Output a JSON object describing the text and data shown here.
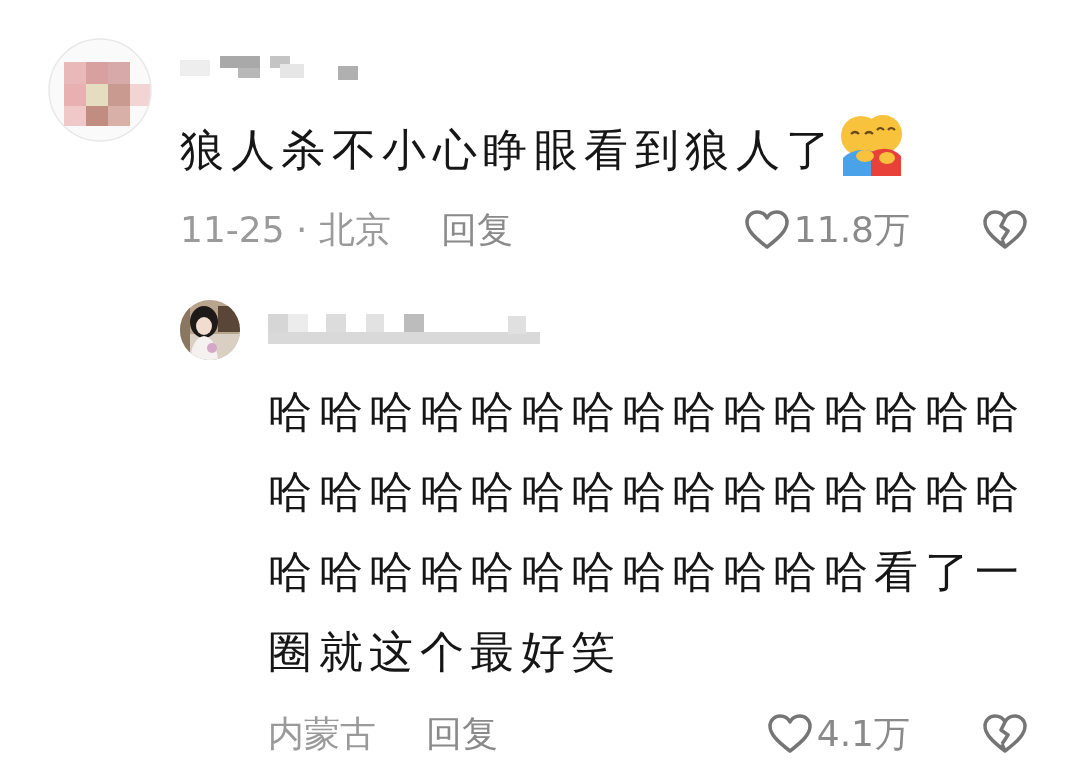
{
  "comments": [
    {
      "text": "狼人杀不小心睁眼看到狼人了",
      "meta": "11-25 · 北京",
      "reply_label": "回复",
      "liked": false,
      "likes": "11.8万",
      "replies": [
        {
          "text": "哈哈哈哈哈哈哈哈哈哈哈哈哈哈哈哈哈哈哈哈哈哈哈哈哈哈哈哈哈哈哈哈哈哈哈哈哈哈哈哈哈哈看了一圈就这个最好笑",
          "meta": "内蒙古",
          "reply_label": "回复",
          "liked": false,
          "likes": "4.1万"
        }
      ]
    }
  ]
}
